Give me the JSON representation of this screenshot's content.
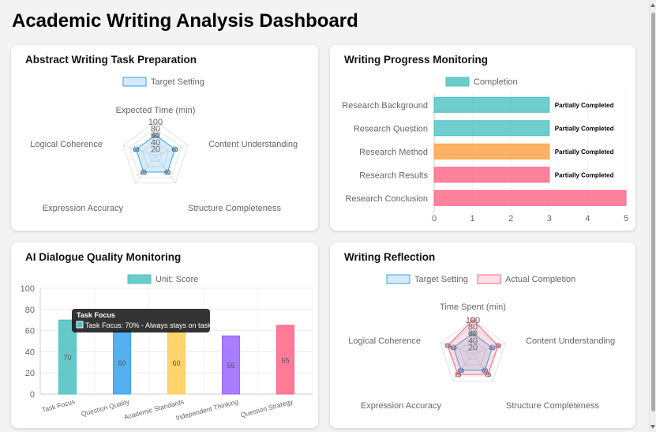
{
  "page": {
    "title": "Academic Writing Analysis Dashboard"
  },
  "colors": {
    "blue": "#36a2eb",
    "blue_fill": "#d6e9f8",
    "teal": "#4bc0c0",
    "teal_fill": "#6ccbcb",
    "orange": "#ff9f40",
    "pink": "#ff6384",
    "purple": "#9966ff",
    "yellow": "#ffcd56"
  },
  "cards": {
    "abstract": {
      "title": "Abstract Writing Task Preparation"
    },
    "progress": {
      "title": "Writing Progress Monitoring"
    },
    "dialogue": {
      "title": "AI Dialogue Quality Monitoring"
    },
    "reflection": {
      "title": "Writing Reflection"
    }
  },
  "tooltip": {
    "title": "Task Focus",
    "body": "Task Focus: 70% - Always stays on task"
  },
  "chart_data": [
    {
      "type": "radar",
      "legend": [
        "Target Setting"
      ],
      "axes": [
        "Expected Time (min)",
        "Content Understanding",
        "Structure Completeness",
        "Expression Accuracy",
        "Logical Coherence"
      ],
      "ticks": [
        "100",
        "80",
        "60",
        "40",
        "20"
      ],
      "range": [
        0,
        100
      ],
      "series": [
        {
          "name": "Target Setting",
          "values": [
            60,
            60,
            60,
            60,
            60
          ],
          "labels": [
            "60",
            "60",
            "60",
            "60",
            "60"
          ]
        }
      ]
    },
    {
      "type": "bar",
      "orientation": "horizontal",
      "legend": [
        "Completion"
      ],
      "categories": [
        "Research Background",
        "Research Question",
        "Research Method",
        "Research Results",
        "Research Conclusion"
      ],
      "values": [
        3,
        3,
        3,
        3,
        5
      ],
      "bar_colors": [
        "#4bc0c0",
        "#4bc0c0",
        "#ff9f40",
        "#ff6384",
        "#ff6384"
      ],
      "data_labels": [
        "Partially Completed",
        "Partially Completed",
        "Partially Completed",
        "Partially Completed",
        ""
      ],
      "xticks": [
        "0",
        "1",
        "2",
        "3",
        "4",
        "5"
      ],
      "xlim": [
        0,
        5
      ]
    },
    {
      "type": "bar",
      "legend": [
        "Unit: Score"
      ],
      "categories": [
        "Task Focus",
        "Question Quality",
        "Academic Standards",
        "Independent Thinking",
        "Question Strategy"
      ],
      "values": [
        70,
        60,
        60,
        55,
        65
      ],
      "value_labels": [
        "70",
        "60",
        "60",
        "55",
        "65"
      ],
      "bar_colors": [
        "#4bc0c0",
        "#36a2eb",
        "#ffcd56",
        "#9966ff",
        "#ff6384"
      ],
      "yticks": [
        "100",
        "80",
        "60",
        "40",
        "20",
        "0"
      ],
      "ylim": [
        0,
        100
      ]
    },
    {
      "type": "radar",
      "legend": [
        "Target Setting",
        "Actual Completion"
      ],
      "axes": [
        "Time Spent (min)",
        "Content Understanding",
        "Structure Completeness",
        "Expression Accuracy",
        "Logical Coherence"
      ],
      "ticks": [
        "100",
        "80",
        "60",
        "40",
        "20"
      ],
      "range": [
        0,
        100
      ],
      "series": [
        {
          "name": "Target Setting",
          "values": [
            60,
            60,
            60,
            60,
            60
          ],
          "labels": [
            "60",
            "60",
            "60",
            "60",
            "60"
          ]
        },
        {
          "name": "Actual Completion",
          "values": [
            100,
            78,
            75,
            75,
            78
          ],
          "labels": [
            "",
            "78",
            "75",
            "75",
            "78"
          ]
        }
      ]
    }
  ]
}
